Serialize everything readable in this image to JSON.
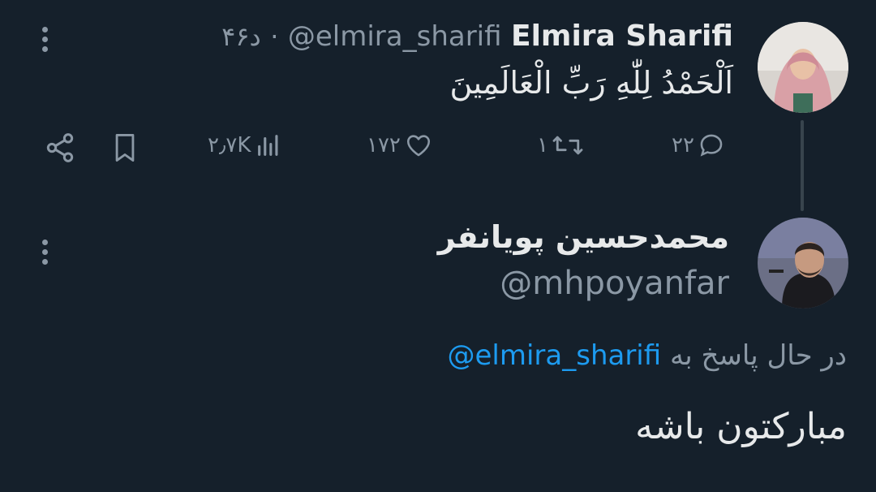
{
  "tweet": {
    "author_name": "Elmira Sharifi",
    "author_handle": "@elmira_sharifi",
    "separator": "·",
    "time": "۴۶د",
    "text": "اَلْحَمْدُ لِلّٰهِ رَبِّ الْعَالَمِينَ",
    "stats": {
      "replies": "۲۲",
      "retweets": "۱",
      "likes": "۱۷۲",
      "views": "۲٫۷K"
    }
  },
  "reply": {
    "author_name": "محمدحسین پویانفر",
    "author_handle": "@mhpoyanfar",
    "replying_to_label": "در حال پاسخ به",
    "replying_to_handle": "@elmira_sharifi",
    "text": "مبارکتون باشه"
  },
  "colors": {
    "background": "#15202b",
    "text": "#e7e9ea",
    "muted": "#8b98a5",
    "link": "#1d9bf0",
    "thread_line": "#38444d"
  },
  "icons": [
    "more-vertical-icon",
    "share-icon",
    "bookmark-icon",
    "views-icon",
    "like-icon",
    "retweet-icon",
    "reply-icon"
  ]
}
